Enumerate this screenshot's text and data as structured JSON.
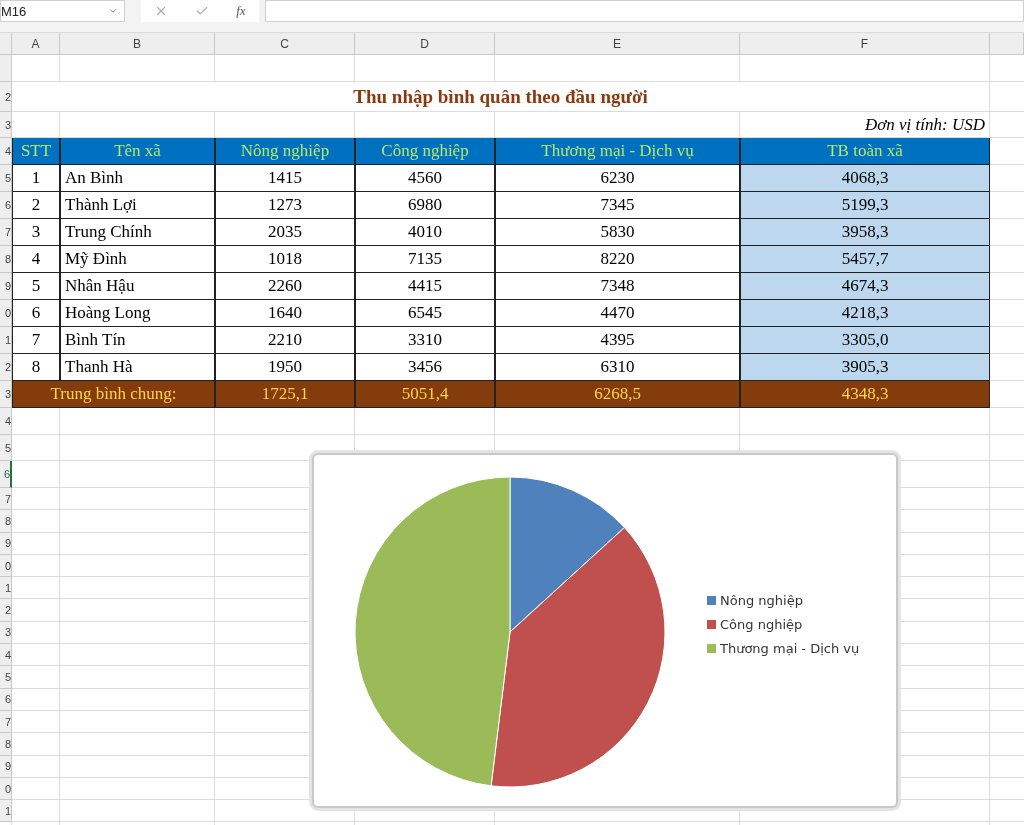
{
  "formula_bar": {
    "name_box": "M16",
    "function_label": "fx"
  },
  "column_headers": [
    "A",
    "B",
    "C",
    "D",
    "E",
    "F"
  ],
  "row_headers": [
    {
      "label": "2",
      "selected": false
    },
    {
      "label": "3",
      "selected": false
    },
    {
      "label": "4",
      "selected": false
    },
    {
      "label": "5",
      "selected": false
    },
    {
      "label": "6",
      "selected": false
    },
    {
      "label": "7",
      "selected": false
    },
    {
      "label": "8",
      "selected": false
    },
    {
      "label": "9",
      "selected": false
    },
    {
      "label": "0",
      "selected": false
    },
    {
      "label": "1",
      "selected": false
    },
    {
      "label": "2",
      "selected": false
    },
    {
      "label": "3",
      "selected": false
    },
    {
      "label": "4",
      "selected": false
    },
    {
      "label": "5",
      "selected": false
    },
    {
      "label": "6",
      "selected": true
    },
    {
      "label": "7",
      "selected": false
    },
    {
      "label": "8",
      "selected": false
    },
    {
      "label": "9",
      "selected": false
    },
    {
      "label": "0",
      "selected": false
    },
    {
      "label": "1",
      "selected": false
    },
    {
      "label": "2",
      "selected": false
    },
    {
      "label": "3",
      "selected": false
    },
    {
      "label": "4",
      "selected": false
    },
    {
      "label": "5",
      "selected": false
    },
    {
      "label": "6",
      "selected": false
    },
    {
      "label": "7",
      "selected": false
    },
    {
      "label": "8",
      "selected": false
    },
    {
      "label": "9",
      "selected": false
    },
    {
      "label": "0",
      "selected": false
    },
    {
      "label": "1",
      "selected": false
    }
  ],
  "sheet": {
    "title": "Thu nhập bình quân theo đầu người",
    "unit": "Đơn vị tính: USD",
    "columns": [
      "STT",
      "Tên xã",
      "Nông nghiệp",
      "Công nghiệp",
      "Thương mại - Dịch vụ",
      "TB toàn xã"
    ],
    "rows": [
      [
        "1",
        "An Bình",
        "1415",
        "4560",
        "6230",
        "4068,3"
      ],
      [
        "2",
        "Thành Lợi",
        "1273",
        "6980",
        "7345",
        "5199,3"
      ],
      [
        "3",
        "Trung Chính",
        "2035",
        "4010",
        "5830",
        "3958,3"
      ],
      [
        "4",
        "Mỹ Đình",
        "1018",
        "7135",
        "8220",
        "5457,7"
      ],
      [
        "5",
        "Nhân Hậu",
        "2260",
        "4415",
        "7348",
        "4674,3"
      ],
      [
        "6",
        "Hoàng Long",
        "1640",
        "6545",
        "4470",
        "4218,3"
      ],
      [
        "7",
        "Bình Tín",
        "2210",
        "3310",
        "4395",
        "3305,0"
      ],
      [
        "8",
        "Thanh Hà",
        "1950",
        "3456",
        "6310",
        "3905,3"
      ]
    ],
    "total": {
      "label": "Trung bình chung:",
      "values": [
        "1725,1",
        "5051,4",
        "6268,5",
        "4348,3"
      ]
    }
  },
  "chart": {
    "legend": [
      {
        "label": "Nông nghiệp",
        "color": "#4f81bd"
      },
      {
        "label": "Công nghiệp",
        "color": "#c0504d"
      },
      {
        "label": "Thương mại - Dịch vụ",
        "color": "#9bbb59"
      }
    ]
  }
}
